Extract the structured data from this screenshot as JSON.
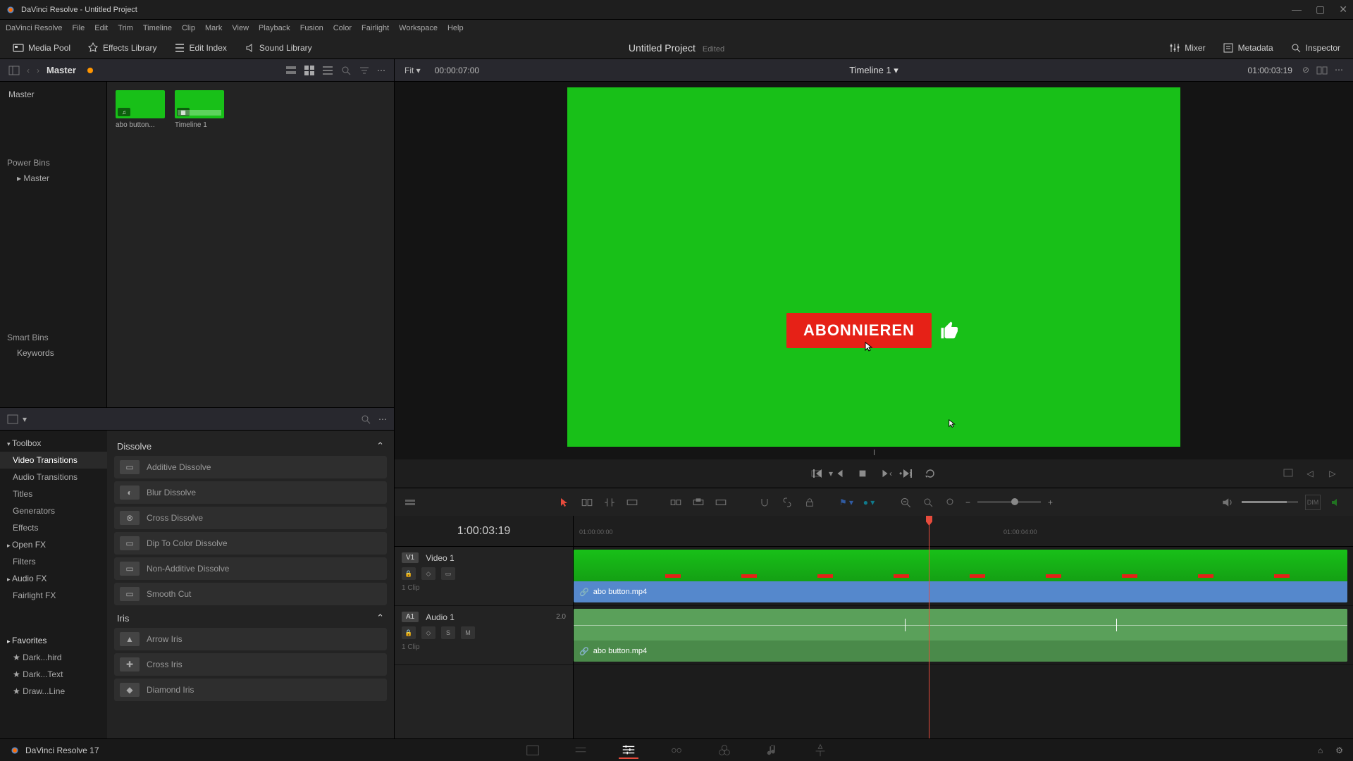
{
  "window": {
    "title": "DaVinci Resolve - Untitled Project"
  },
  "menus": [
    "DaVinci Resolve",
    "File",
    "Edit",
    "Trim",
    "Timeline",
    "Clip",
    "Mark",
    "View",
    "Playback",
    "Fusion",
    "Color",
    "Fairlight",
    "Workspace",
    "Help"
  ],
  "toolbar": {
    "media_pool": "Media Pool",
    "effects_library": "Effects Library",
    "edit_index": "Edit Index",
    "sound_library": "Sound Library",
    "mixer": "Mixer",
    "metadata": "Metadata",
    "inspector": "Inspector",
    "project_title": "Untitled Project",
    "project_status": "Edited"
  },
  "media": {
    "title": "Master",
    "tree": {
      "root": "Master",
      "power_bins": "Power Bins",
      "power_master": "Master",
      "smart_bins": "Smart Bins",
      "keywords": "Keywords"
    },
    "clips": [
      {
        "name": "abo button...",
        "type": "video"
      },
      {
        "name": "Timeline 1",
        "type": "timeline"
      }
    ]
  },
  "effects": {
    "tree": {
      "toolbox": "Toolbox",
      "video_trans": "Video Transitions",
      "audio_trans": "Audio Transitions",
      "titles": "Titles",
      "generators": "Generators",
      "effects": "Effects",
      "openfx": "Open FX",
      "filters": "Filters",
      "audiofx": "Audio FX",
      "fairlight": "Fairlight FX",
      "favorites": "Favorites",
      "fav1": "Dark...hird",
      "fav2": "Dark...Text",
      "fav3": "Draw...Line"
    },
    "dissolve_header": "Dissolve",
    "dissolve_items": [
      "Additive Dissolve",
      "Blur Dissolve",
      "Cross Dissolve",
      "Dip To Color Dissolve",
      "Non-Additive Dissolve",
      "Smooth Cut"
    ],
    "iris_header": "Iris",
    "iris_items": [
      "Arrow Iris",
      "Cross Iris",
      "Diamond Iris"
    ]
  },
  "viewer": {
    "fit": "Fit",
    "tc_left": "00:00:07:00",
    "title": "Timeline 1",
    "tc_right": "01:00:03:19",
    "subscribe_text": "ABONNIEREN"
  },
  "timeline": {
    "tc": "1:00:03:19",
    "ruler_ticks": [
      {
        "label": "01:00:00:00",
        "pos": 8
      },
      {
        "label": "01:00:04:00",
        "pos": 610
      }
    ],
    "video_track": {
      "badge": "V1",
      "name": "Video 1",
      "clips": "1 Clip",
      "clip_name": "abo button.mp4"
    },
    "audio_track": {
      "badge": "A1",
      "name": "Audio 1",
      "level": "2.0",
      "clips": "1 Clip",
      "clip_name": "abo button.mp4"
    }
  },
  "bottombar": {
    "version": "DaVinci Resolve 17"
  }
}
